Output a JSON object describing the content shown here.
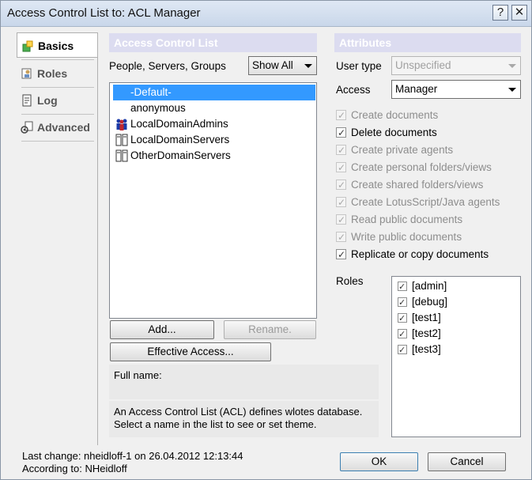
{
  "window": {
    "title": "Access Control List to: ACL Manager",
    "help_label": "?",
    "close_label": "✕"
  },
  "tabs": [
    {
      "label": "Basics",
      "icon": "basics-icon",
      "active": true
    },
    {
      "label": "Roles",
      "icon": "roles-icon",
      "active": false
    },
    {
      "label": "Log",
      "icon": "log-icon",
      "active": false
    },
    {
      "label": "Advanced",
      "icon": "advanced-icon",
      "active": false
    }
  ],
  "acl": {
    "header": "Access Control List",
    "filter_label": "People, Servers, Groups",
    "filter_value": "Show All",
    "entries": [
      {
        "name": "-Default-",
        "icon": "none",
        "selected": true
      },
      {
        "name": "anonymous",
        "icon": "none",
        "selected": false
      },
      {
        "name": "LocalDomainAdmins",
        "icon": "group-icon",
        "selected": false
      },
      {
        "name": "LocalDomainServers",
        "icon": "server-icon",
        "selected": false
      },
      {
        "name": "OtherDomainServers",
        "icon": "server-icon",
        "selected": false
      }
    ],
    "add_label": "Add...",
    "rename_label": "Rename.",
    "effective_access_label": "Effective Access...",
    "full_name_label": "Full name:",
    "info_line1": "An Access Control List (ACL) defines wlotes database.",
    "info_line2": "Select a name in the list to see or set theme."
  },
  "attributes": {
    "header": "Attributes",
    "user_type_label": "User type",
    "user_type_value": "Unspecified",
    "access_label": "Access",
    "access_value": "Manager",
    "checkboxes": [
      {
        "label": "Create documents",
        "checked": true,
        "enabled": false
      },
      {
        "label": "Delete documents",
        "checked": true,
        "enabled": true
      },
      {
        "label": "Create private agents",
        "checked": true,
        "enabled": false
      },
      {
        "label": "Create personal folders/views",
        "checked": true,
        "enabled": false
      },
      {
        "label": "Create shared folders/views",
        "checked": true,
        "enabled": false
      },
      {
        "label": "Create LotusScript/Java agents",
        "checked": true,
        "enabled": false
      },
      {
        "label": "Read public documents",
        "checked": true,
        "enabled": false
      },
      {
        "label": "Write public documents",
        "checked": true,
        "enabled": false
      },
      {
        "label": "Replicate or copy documents",
        "checked": true,
        "enabled": true
      }
    ],
    "roles_label": "Roles",
    "roles": [
      "[admin]",
      "[debug]",
      "[test1]",
      "[test2]",
      "[test3]"
    ]
  },
  "footer": {
    "last_change": "Last change: nheidloff-1 on 26.04.2012 12:13:44",
    "according_to": "According to: NHeidloff",
    "ok_label": "OK",
    "cancel_label": "Cancel"
  }
}
